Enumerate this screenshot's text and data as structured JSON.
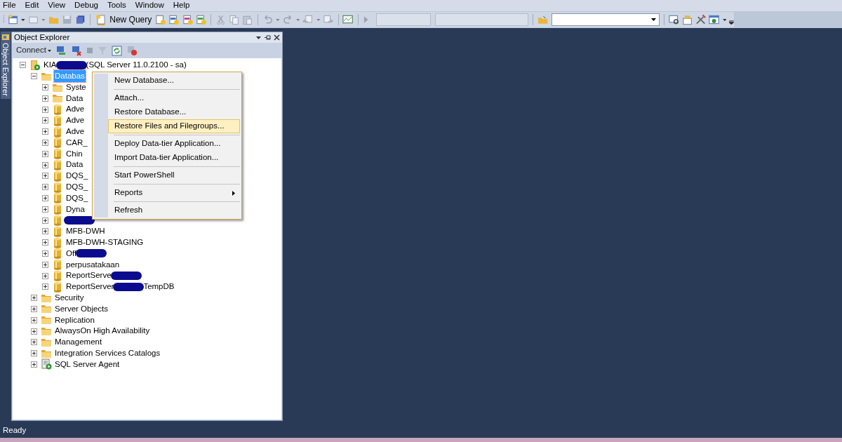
{
  "menu_bar": [
    "File",
    "Edit",
    "View",
    "Debug",
    "Tools",
    "Window",
    "Help"
  ],
  "toolbar": {
    "new_query": "New Query"
  },
  "side_tab": "Object Explorer",
  "object_explorer": {
    "title": "Object Explorer",
    "connect": "Connect",
    "tree": [
      {
        "kind": "server",
        "label": "KIA",
        "redacted": true,
        "label_after": "(SQL Server 11.0.2100 - sa)",
        "expanded": true,
        "selected": false,
        "children": [
          {
            "kind": "folder",
            "label": "Databas",
            "expanded": true,
            "selected": true,
            "children": [
              {
                "kind": "folder",
                "label": "Syste",
                "expanded": false,
                "selected": false
              },
              {
                "kind": "folder",
                "label": "Data",
                "expanded": false,
                "selected": false
              },
              {
                "kind": "database",
                "label": "Adve",
                "expanded": false,
                "selected": false
              },
              {
                "kind": "database",
                "label": "Adve",
                "expanded": false,
                "selected": false
              },
              {
                "kind": "database",
                "label": "Adve",
                "expanded": false,
                "selected": false
              },
              {
                "kind": "database",
                "label": "CAR_",
                "expanded": false,
                "selected": false
              },
              {
                "kind": "database",
                "label": "Chin",
                "expanded": false,
                "selected": false
              },
              {
                "kind": "database",
                "label": "Data",
                "expanded": false,
                "selected": false
              },
              {
                "kind": "database",
                "label": "DQS_",
                "expanded": false,
                "selected": false
              },
              {
                "kind": "database",
                "label": "DQS_",
                "expanded": false,
                "selected": false
              },
              {
                "kind": "database",
                "label": "DQS_",
                "expanded": false,
                "selected": false
              },
              {
                "kind": "database",
                "label": "Dyna",
                "expanded": false,
                "selected": false
              },
              {
                "kind": "database",
                "redacted": true,
                "expanded": false,
                "selected": false
              },
              {
                "kind": "database",
                "label": "MFB-DWH",
                "expanded": false,
                "selected": false
              },
              {
                "kind": "database",
                "label": "MFB-DWH-STAGING",
                "expanded": false,
                "selected": false
              },
              {
                "kind": "database",
                "label": "Off",
                "redacted": true,
                "expanded": false,
                "selected": false
              },
              {
                "kind": "database",
                "label": "perpusatakaan",
                "expanded": false,
                "selected": false
              },
              {
                "kind": "database",
                "label": "ReportServe",
                "redacted": true,
                "expanded": false,
                "selected": false
              },
              {
                "kind": "database",
                "label": "ReportServer",
                "redacted": true,
                "label_after": "TempDB",
                "expanded": false,
                "selected": false
              }
            ]
          },
          {
            "kind": "folder",
            "label": "Security",
            "expanded": false,
            "selected": false
          },
          {
            "kind": "folder",
            "label": "Server Objects",
            "expanded": false,
            "selected": false
          },
          {
            "kind": "folder",
            "label": "Replication",
            "expanded": false,
            "selected": false
          },
          {
            "kind": "folder",
            "label": "AlwaysOn High Availability",
            "expanded": false,
            "selected": false
          },
          {
            "kind": "folder",
            "label": "Management",
            "expanded": false,
            "selected": false
          },
          {
            "kind": "folder",
            "label": "Integration Services Catalogs",
            "expanded": false,
            "selected": false
          },
          {
            "kind": "agent",
            "label": "SQL Server Agent",
            "expanded": false,
            "selected": false
          }
        ]
      }
    ]
  },
  "context_menu": [
    {
      "kind": "item",
      "label": "New Database...",
      "selected": false,
      "submenu": false
    },
    {
      "kind": "separator"
    },
    {
      "kind": "item",
      "label": "Attach...",
      "selected": false,
      "submenu": false
    },
    {
      "kind": "item",
      "label": "Restore Database...",
      "selected": false,
      "submenu": false
    },
    {
      "kind": "item",
      "label": "Restore Files and Filegroups...",
      "selected": true,
      "submenu": false
    },
    {
      "kind": "separator"
    },
    {
      "kind": "item",
      "label": "Deploy Data-tier Application...",
      "selected": false,
      "submenu": false
    },
    {
      "kind": "item",
      "label": "Import Data-tier Application...",
      "selected": false,
      "submenu": false
    },
    {
      "kind": "separator"
    },
    {
      "kind": "item",
      "label": "Start PowerShell",
      "selected": false,
      "submenu": false
    },
    {
      "kind": "separator"
    },
    {
      "kind": "item",
      "label": "Reports",
      "selected": false,
      "submenu": true
    },
    {
      "kind": "separator"
    },
    {
      "kind": "item",
      "label": "Refresh",
      "selected": false,
      "submenu": false
    }
  ],
  "status_bar": "Ready"
}
